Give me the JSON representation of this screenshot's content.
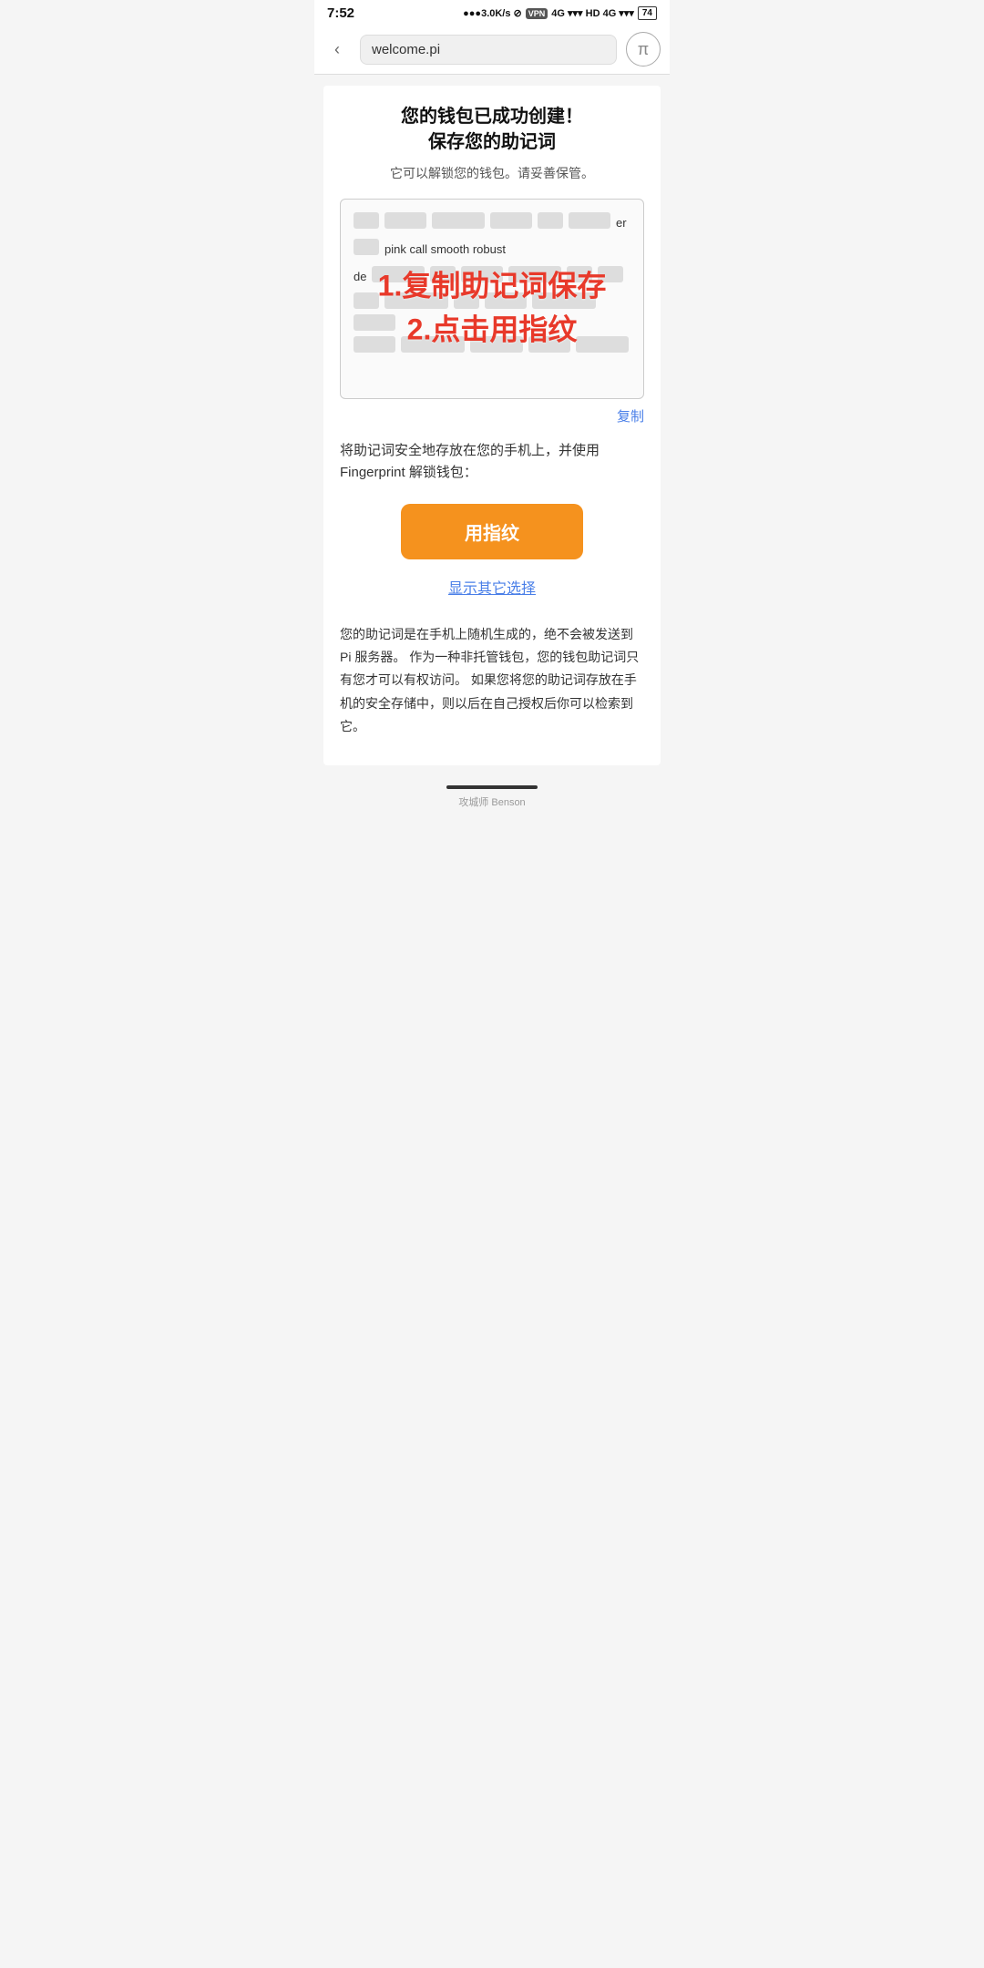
{
  "statusBar": {
    "time": "7:52",
    "signal": "●●●3.0K/s",
    "vpn": "VPN",
    "network": "4G",
    "battery": "74"
  },
  "browserBar": {
    "url": "welcome.pi",
    "backIcon": "‹",
    "piSymbol": "π"
  },
  "page": {
    "title": "您的钱包已成功创建！\\n 保存您的助记词",
    "subtitle": "它可以解锁您的钱包。请妥善保管。",
    "mnemonicVisibleWords": "pink call smooth robust",
    "overlayLine1": "1.复制助记词保存",
    "overlayLine2": "2.点击用指纹",
    "copyLabel": "复制",
    "instructionText": "将助记词安全地存放在您的手机上，并使用Fingerprint 解锁钱包：",
    "fingerprintBtnLabel": "用指纹",
    "showOptionsLabel": "显示其它选择",
    "footerNote": "您的助记词是在手机上随机生成的，绝不会被发送到Pi 服务器。 作为一种非托管钱包，您的钱包助记词只有您才可以有权访问。 如果您将您的助记词存放在手机的安全存储中，则以后在自己授权后你可以检索到它。",
    "watermark": "攻城师 Benson"
  }
}
